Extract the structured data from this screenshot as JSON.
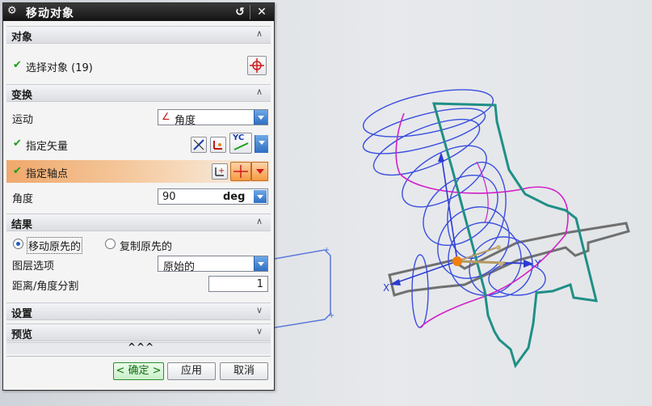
{
  "dialog": {
    "title": "移动对象",
    "sections": {
      "object": {
        "label": "对象",
        "select_object_label": "选择对象 (19)"
      },
      "transform": {
        "label": "变换",
        "motion_label": "运动",
        "motion_value": "角度",
        "vector_label": "指定矢量",
        "vector_dropdown_label": "YC",
        "pivot_label": "指定轴点",
        "angle_label": "角度",
        "angle_value": "90",
        "angle_unit": "deg"
      },
      "result": {
        "label": "结果",
        "move_original_label": "移动原先的",
        "copy_original_label": "复制原先的",
        "selected_option": "move",
        "layer_option_label": "图层选项",
        "layer_option_value": "原始的",
        "distance_angle_label": "距离/角度分割",
        "distance_angle_value": "1"
      },
      "settings": {
        "label": "设置"
      },
      "preview": {
        "label": "预览"
      }
    },
    "collapse_label": "^^^",
    "buttons": {
      "ok": "< 确定 >",
      "apply": "应用",
      "cancel": "取消"
    }
  },
  "viewport": {
    "axis_labels": {
      "x": "X",
      "y": "Y"
    },
    "colors": {
      "helix_blue": "#3a4ee0",
      "curve_magenta": "#d21fc8",
      "outline_teal": "#1f8f86",
      "plane_gray": "#6f6f6f",
      "origin_orange": "#f07f10"
    }
  }
}
